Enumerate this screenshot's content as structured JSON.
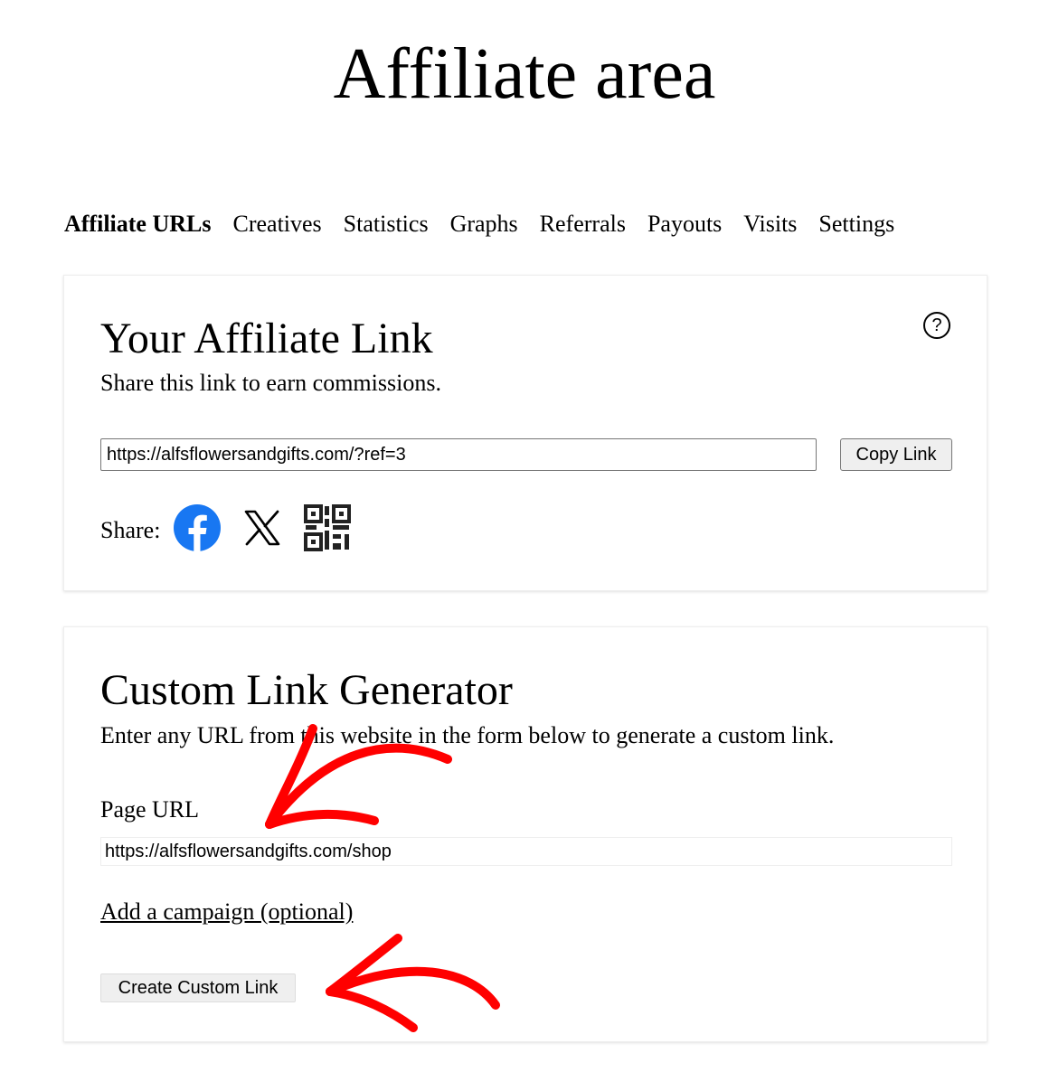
{
  "page": {
    "title": "Affiliate area"
  },
  "tabs": [
    {
      "label": "Affiliate URLs",
      "active": true
    },
    {
      "label": "Creatives"
    },
    {
      "label": "Statistics"
    },
    {
      "label": "Graphs"
    },
    {
      "label": "Referrals"
    },
    {
      "label": "Payouts"
    },
    {
      "label": "Visits"
    },
    {
      "label": "Settings"
    }
  ],
  "affiliate_link": {
    "title": "Your Affiliate Link",
    "description": "Share this link to earn commissions.",
    "help_icon": "question-circle-icon",
    "url": "https://alfsflowersandgifts.com/?ref=3",
    "copy_label": "Copy Link",
    "share_label": "Share:",
    "share_icons": [
      "facebook-icon",
      "x-icon",
      "qr-code-icon"
    ],
    "facebook_color": "#1877F2"
  },
  "custom_link": {
    "title": "Custom Link Generator",
    "description": "Enter any URL from this website in the form below to generate a custom link.",
    "page_url_label": "Page URL",
    "page_url_value": "https://alfsflowersandgifts.com/shop",
    "campaign_link": "Add a campaign (optional)",
    "create_label": "Create Custom Link"
  },
  "annotation_color": "#FF0000"
}
